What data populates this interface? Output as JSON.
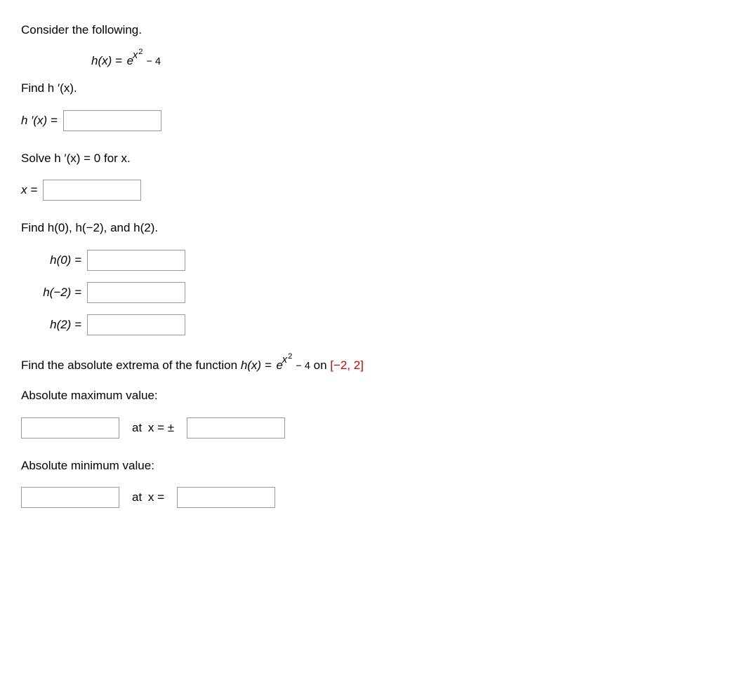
{
  "intro": "Consider the following.",
  "function": {
    "lhs": "h(x) = ",
    "base": "e",
    "exp_var": "x",
    "exp_pow": "2",
    "exp_tail": " − 4"
  },
  "findHprime": "Find h ′(x).",
  "hprime_label": "h ′(x) =",
  "solveHprime": "Solve h ′(x) = 0 for x.",
  "x_label": "x =",
  "findValues": "Find h(0), h(−2), and h(2).",
  "h0_label": "h(0)  =",
  "hminus2_label": "h(−2)  =",
  "h2_label": "h(2)  =",
  "extrema_intro_pre": "Find the absolute extrema of the function ",
  "extrema_lhs": "h(x) = ",
  "extrema_on": " on ",
  "extrema_interval": "[−2, 2]",
  "abs_max_label": "Absolute maximum value:",
  "at_x_pm": "at x = ±",
  "abs_min_label": "Absolute minimum value:",
  "at_x": "at x ="
}
